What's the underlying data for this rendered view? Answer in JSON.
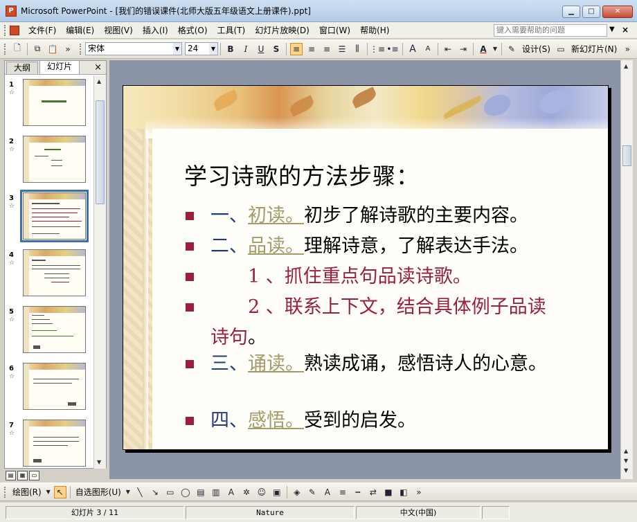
{
  "window": {
    "app_name": "Microsoft PowerPoint",
    "doc_title": "[我们的错误课件(北师大版五年级语文上册课件).ppt]",
    "app_icon": "powerpoint-icon"
  },
  "menu": {
    "items": [
      "文件(F)",
      "编辑(E)",
      "视图(V)",
      "插入(I)",
      "格式(O)",
      "工具(T)",
      "幻灯片放映(D)",
      "窗口(W)",
      "帮助(H)"
    ],
    "help_placeholder": "键入需要帮助的问题"
  },
  "toolbar": {
    "font_name": "宋体",
    "font_size": "24",
    "bold": "B",
    "italic": "I",
    "underline": "U",
    "shadow": "S",
    "grow_font": "A",
    "shrink_font": "A",
    "font_color": "A",
    "design_label": "设计(S)",
    "new_slide_label": "新幻灯片(N)"
  },
  "left_pane": {
    "tab_outline": "大纲",
    "tab_slides": "幻灯片",
    "close": "×",
    "slide_numbers": [
      "1",
      "2",
      "3",
      "4",
      "5",
      "6",
      "7"
    ],
    "selected_slide": 3
  },
  "slide": {
    "title": "学习诗歌的方法步骤：",
    "bullets": [
      {
        "num": "一、",
        "link": "初读。",
        "text": "初步了解诗歌的主要内容。"
      },
      {
        "num": "二、",
        "link": "品读。",
        "text": "理解诗意，了解表达手法。"
      },
      {
        "sub": "1 、抓住重点句品读诗歌。"
      },
      {
        "sub": "2 、联系上下文，结合具体例子品读",
        "sub2": "诗句",
        "tail": "。"
      },
      {
        "num": "三、",
        "link": "诵读。",
        "text": "熟读成诵，感悟诗人的心意。"
      },
      {
        "num": "四、",
        "link": "感悟。",
        "text": "受到的启发。"
      }
    ]
  },
  "drawing_toolbar": {
    "draw_label": "绘图(R)",
    "autoshape_label": "自选图形(U)"
  },
  "status": {
    "slide_position": "幻灯片 3 / 11",
    "design_name": "Nature",
    "language": "中文(中国)"
  },
  "colors": {
    "bullet": "#9b1f3a",
    "number_blue": "#1f3b80",
    "link": "#a39b6a",
    "selection": "#3c6fb0"
  }
}
